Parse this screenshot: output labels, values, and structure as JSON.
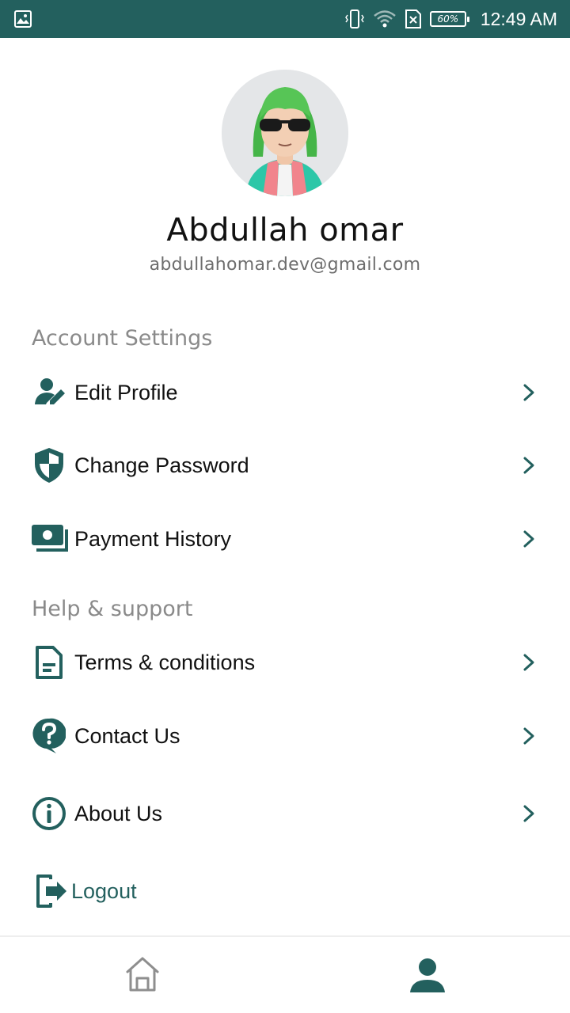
{
  "status_bar": {
    "battery": "60%",
    "time": "12:49 AM",
    "icons": [
      "gallery-icon",
      "vibrate-icon",
      "wifi-icon",
      "no-sim-icon",
      "battery-icon"
    ]
  },
  "profile": {
    "name": "Abdullah omar",
    "email": "abdullahomar.dev@gmail.com"
  },
  "account_settings": {
    "title": "Account Settings",
    "items": [
      {
        "label": "Edit Profile",
        "icon": "edit-profile-icon"
      },
      {
        "label": "Change Password",
        "icon": "shield-icon"
      },
      {
        "label": "Payment History",
        "icon": "payment-icon"
      }
    ]
  },
  "help_support": {
    "title": "Help & support",
    "items": [
      {
        "label": "Terms & conditions",
        "icon": "document-icon"
      },
      {
        "label": "Contact Us",
        "icon": "question-icon"
      },
      {
        "label": "About Us",
        "icon": "info-icon"
      }
    ]
  },
  "logout": {
    "label": "Logout",
    "icon": "logout-icon"
  },
  "bottom_nav": {
    "items": [
      "home-icon",
      "person-icon"
    ],
    "active": "person-icon"
  },
  "colors": {
    "primary": "#23605e",
    "text": "#111111",
    "muted": "#8a8a8a"
  }
}
